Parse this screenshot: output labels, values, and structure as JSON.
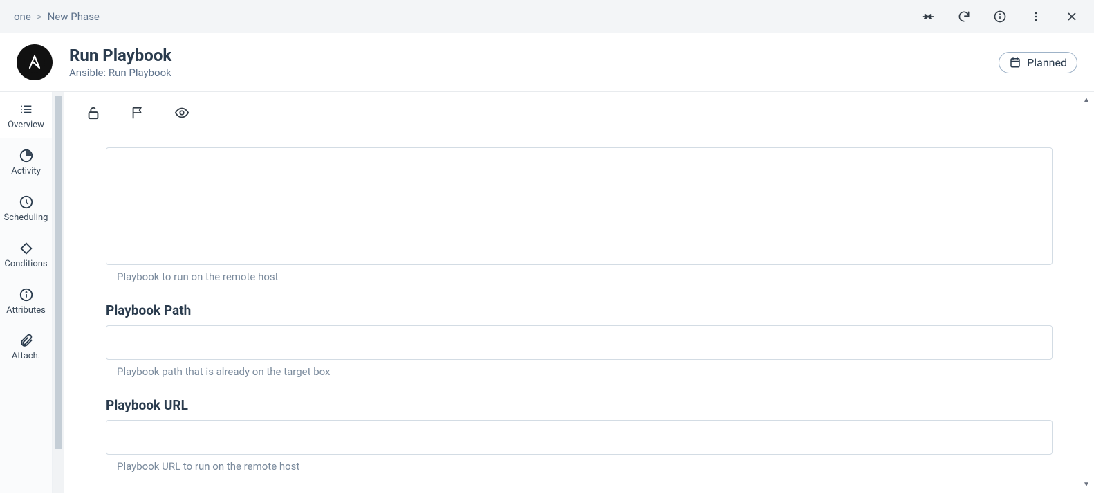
{
  "breadcrumb": {
    "root": "one",
    "current": "New Phase"
  },
  "header": {
    "title": "Run Playbook",
    "subtitle": "Ansible: Run Playbook",
    "status": "Planned"
  },
  "sideNav": {
    "items": [
      {
        "label": "Overview"
      },
      {
        "label": "Activity"
      },
      {
        "label": "Scheduling"
      },
      {
        "label": "Conditions"
      },
      {
        "label": "Attributes"
      },
      {
        "label": "Attach."
      }
    ]
  },
  "form": {
    "playbook_helper": "Playbook to run on the remote host",
    "playbook_path_label": "Playbook Path",
    "playbook_path_value": "",
    "playbook_path_helper": "Playbook path that is already on the target box",
    "playbook_url_label": "Playbook URL",
    "playbook_url_value": "",
    "playbook_url_helper": "Playbook URL to run on the remote host"
  }
}
